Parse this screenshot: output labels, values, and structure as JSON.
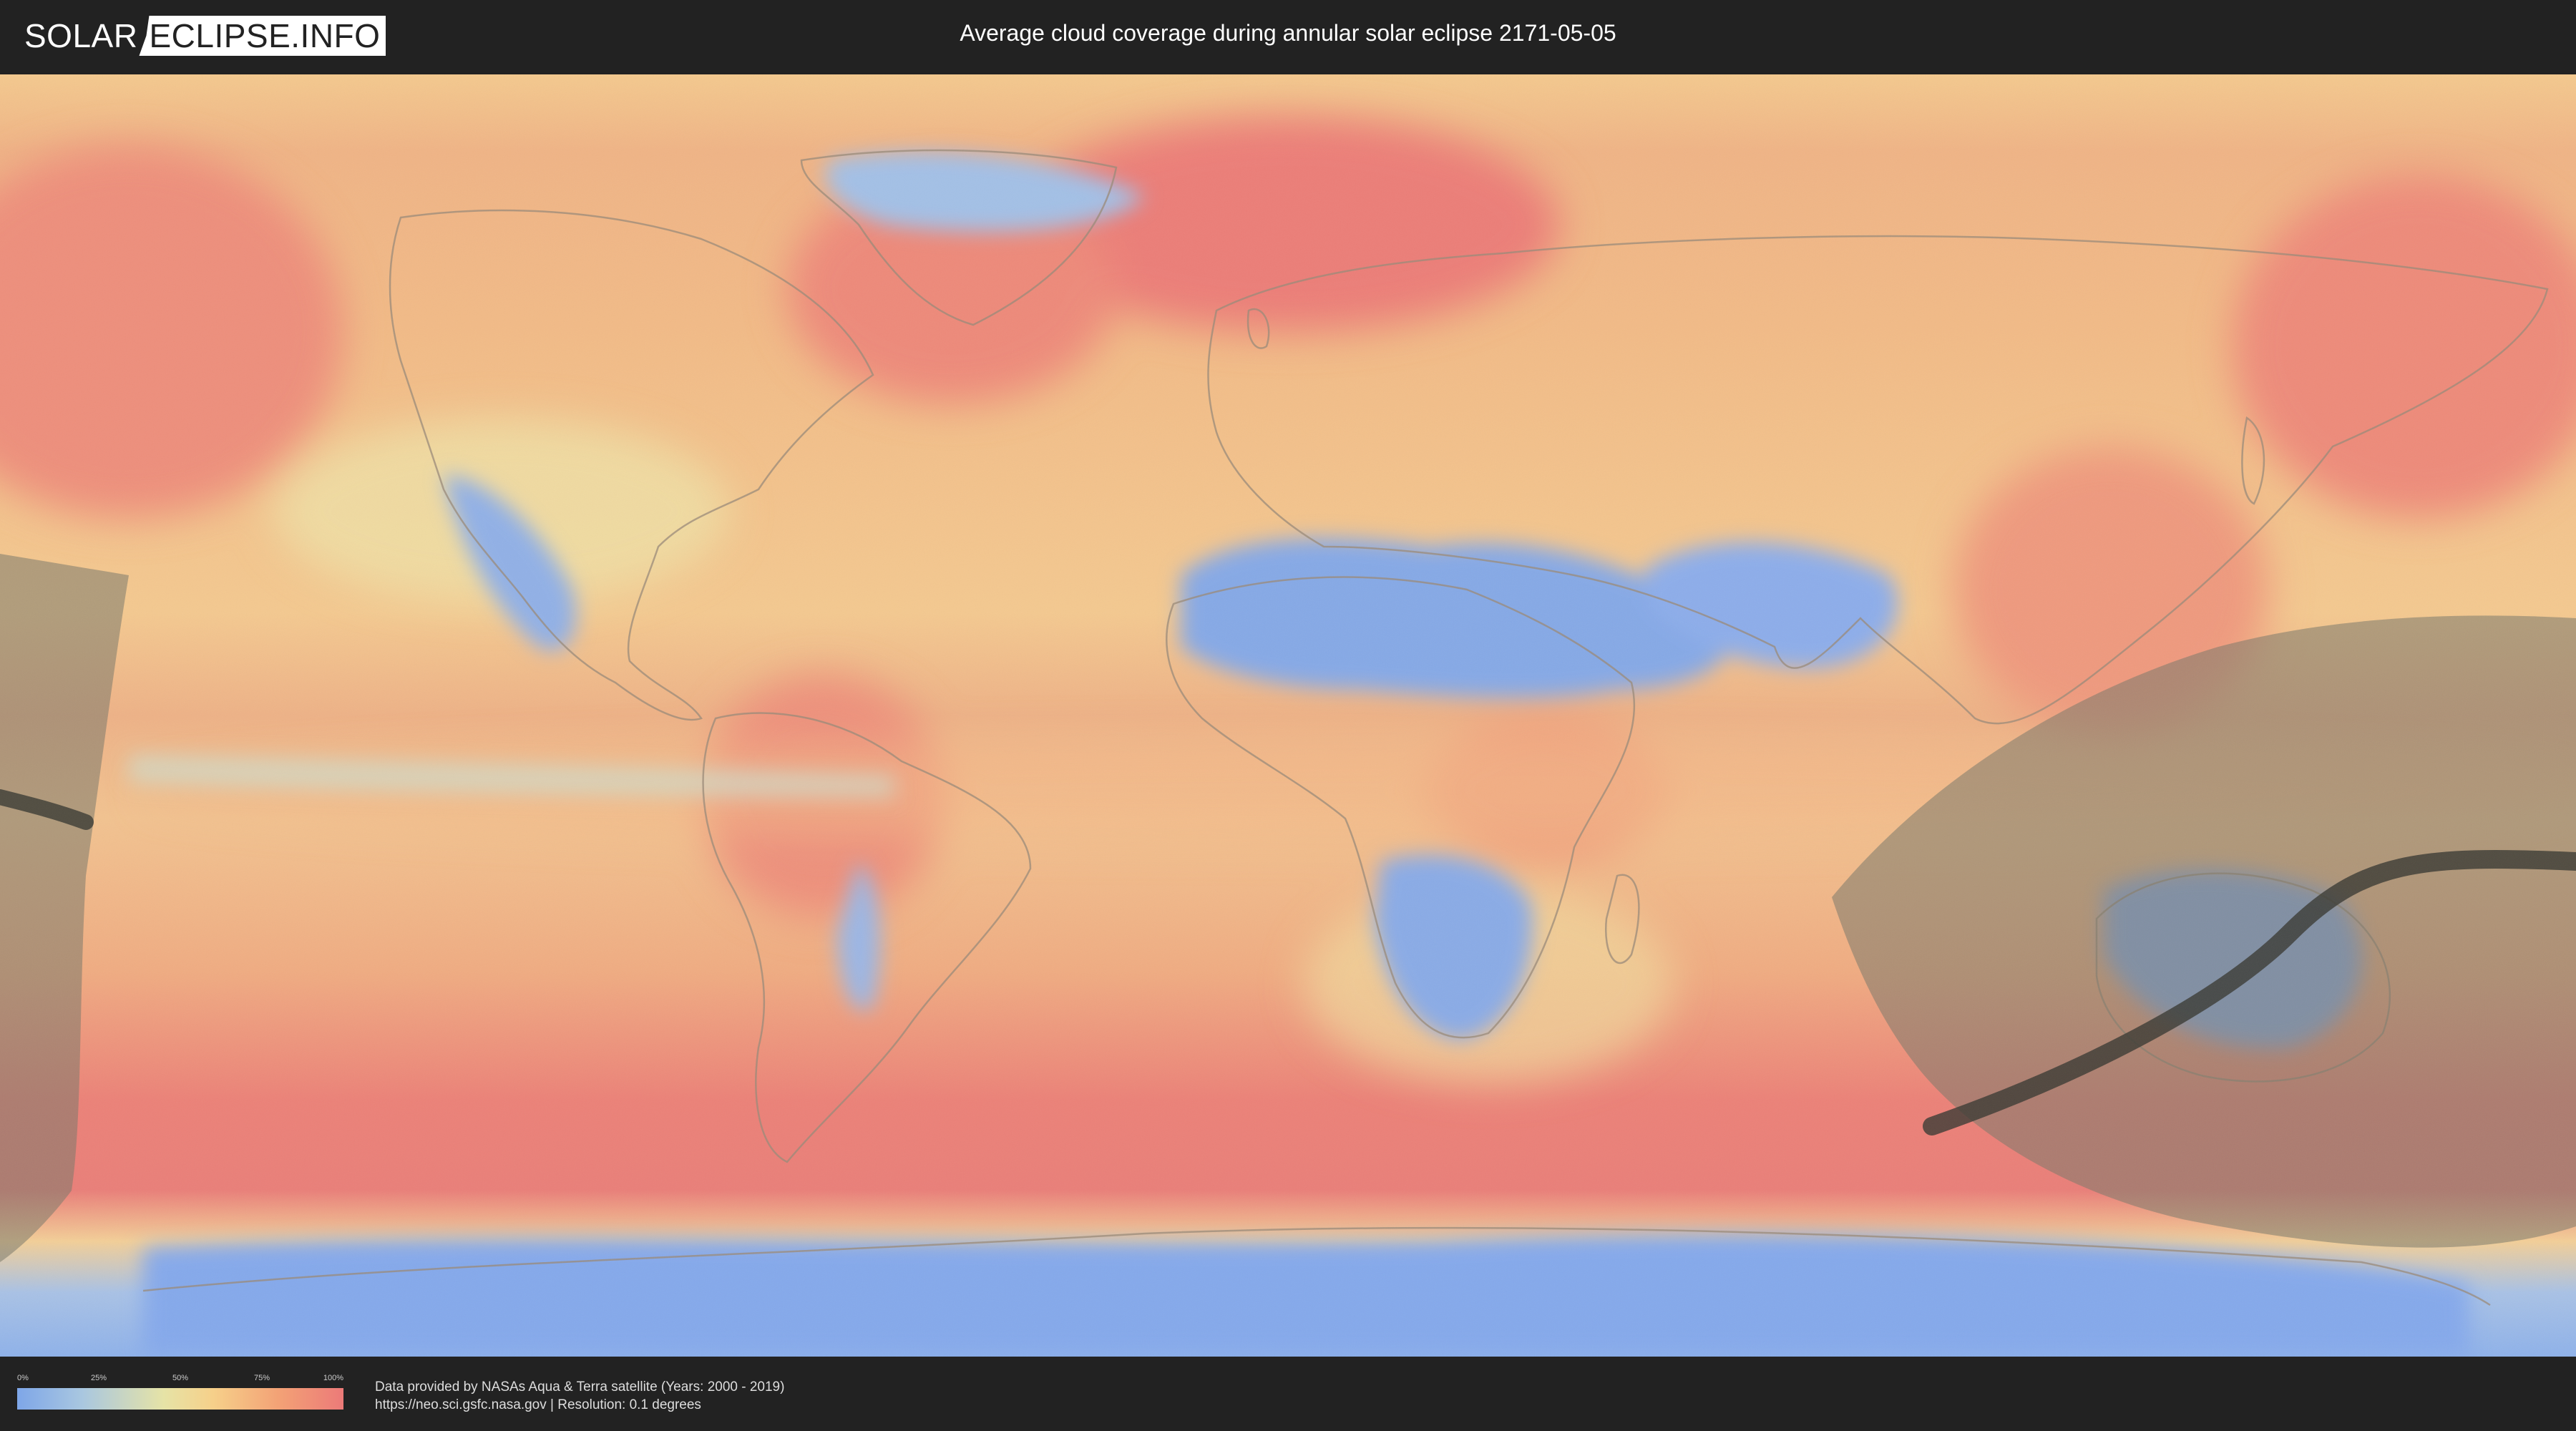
{
  "header": {
    "logo_left": "SOLAR",
    "logo_right": "ECLIPSE.INFO",
    "title": "Average cloud coverage during annular solar eclipse 2171-05-05"
  },
  "legend": {
    "ticks": [
      "0%",
      "25%",
      "50%",
      "75%",
      "100%"
    ],
    "tick_values": [
      0,
      25,
      50,
      75,
      100
    ],
    "colors": [
      "#7ea6e8",
      "#a9c7e0",
      "#e6e3a6",
      "#f6d08a",
      "#f3a276",
      "#ec7a78"
    ]
  },
  "credits": {
    "line1": "Data provided by NASAs Aqua & Terra satellite (Years: 2000 - 2019)",
    "line2": "https://neo.sci.gsfc.nasa.gov | Resolution: 0.1 degrees"
  },
  "map": {
    "icons": [
      "eclipse-visibility-zone",
      "annularity-path"
    ],
    "colors": {
      "clear": "#7ea6e8",
      "low": "#a9c7e0",
      "mid": "#e6e3a6",
      "high": "#f3a276",
      "overcast": "#ec7a78",
      "zone": "#6e6e63",
      "path": "#3b3b35"
    }
  }
}
